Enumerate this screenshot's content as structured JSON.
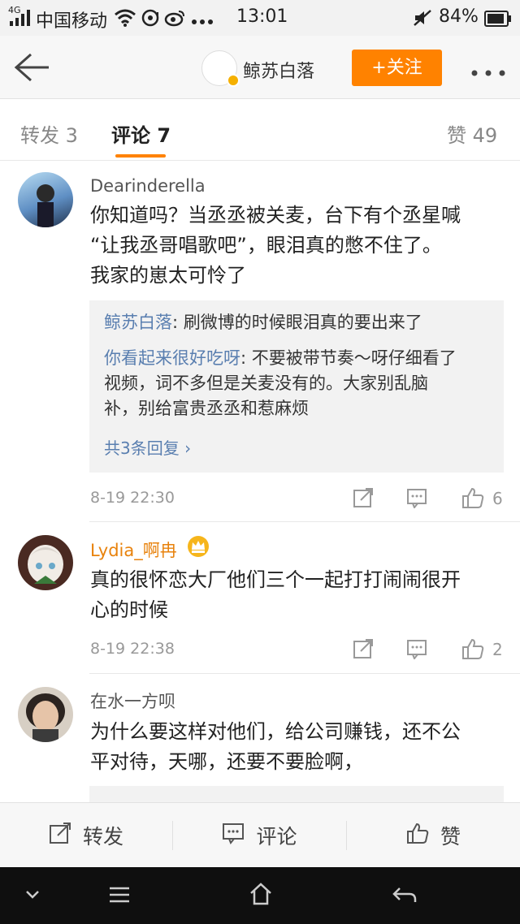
{
  "status_bar": {
    "carrier": "中国移动",
    "network": "4G",
    "time": "13:01",
    "battery": "84%"
  },
  "header": {
    "username": "鲸苏白落",
    "follow_label": "+关注"
  },
  "tabs": {
    "repost": "转发 3",
    "comments": "评论 7",
    "likes": "赞 49"
  },
  "comments": [
    {
      "username": "Dearinderella",
      "lines": [
        "你知道吗？当丞丞被关麦，台下有个丞星喊",
        "“让我丞哥唱歌吧”，眼泪真的憋不住了。",
        "我家的崽太可怜了"
      ],
      "replies": [
        {
          "name": "鲸苏白落",
          "text": ": 刷微博的时候眼泪真的要出来了"
        },
        {
          "name": "你看起来很好吃呀",
          "lines": [
            ": 不要被带节奏～呀仔细看了",
            "视频，词不多但是关麦没有的。大家别乱脑",
            "补，别给富贵丞丞和惹麻烦"
          ]
        }
      ],
      "more_replies": "共3条回复 ›",
      "time": "8-19 22:30",
      "likes": "6"
    },
    {
      "username": "Lydia_啊冉",
      "username_color": "#e8820c",
      "lines": [
        "真的很怀恋大厂他们三个一起打打闹闹很开",
        "心的时候"
      ],
      "time": "8-19 22:38",
      "likes": "2"
    },
    {
      "username": "在水一方呗",
      "lines": [
        "为什么要这样对他们，给公司赚钱，还不公",
        "平对待，天哪，还要不要脸啊，"
      ]
    }
  ],
  "bottom_bar": {
    "repost": "转发",
    "comment": "评论",
    "like": "赞"
  },
  "colors": {
    "accent_orange": "#ff8200",
    "link_blue": "#5a7fb0",
    "vip_orange": "#e8820c"
  }
}
